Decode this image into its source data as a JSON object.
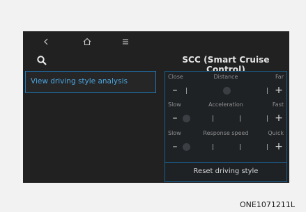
{
  "header": {
    "title": "SCC (Smart Cruise Control)"
  },
  "nav": {
    "icons": [
      "back-icon",
      "home-icon",
      "menu-icon",
      "search-icon"
    ]
  },
  "left_panel": {
    "item_label": "View driving style analysis"
  },
  "settings": {
    "rows": [
      {
        "min_label": "Close",
        "name": "Distance",
        "max_label": "Far",
        "level_fraction": 0.5
      },
      {
        "min_label": "Slow",
        "name": "Acceleration",
        "max_label": "Fast",
        "level_fraction": 0.0
      },
      {
        "min_label": "Slow",
        "name": "Response speed",
        "max_label": "Quick",
        "level_fraction": 0.0
      }
    ],
    "reset_label": "Reset driving style"
  },
  "image_code": "ONE1071211L",
  "colors": {
    "accent": "#1e7ab8",
    "highlight_text": "#4aa4de",
    "screen_bg": "#212121"
  }
}
